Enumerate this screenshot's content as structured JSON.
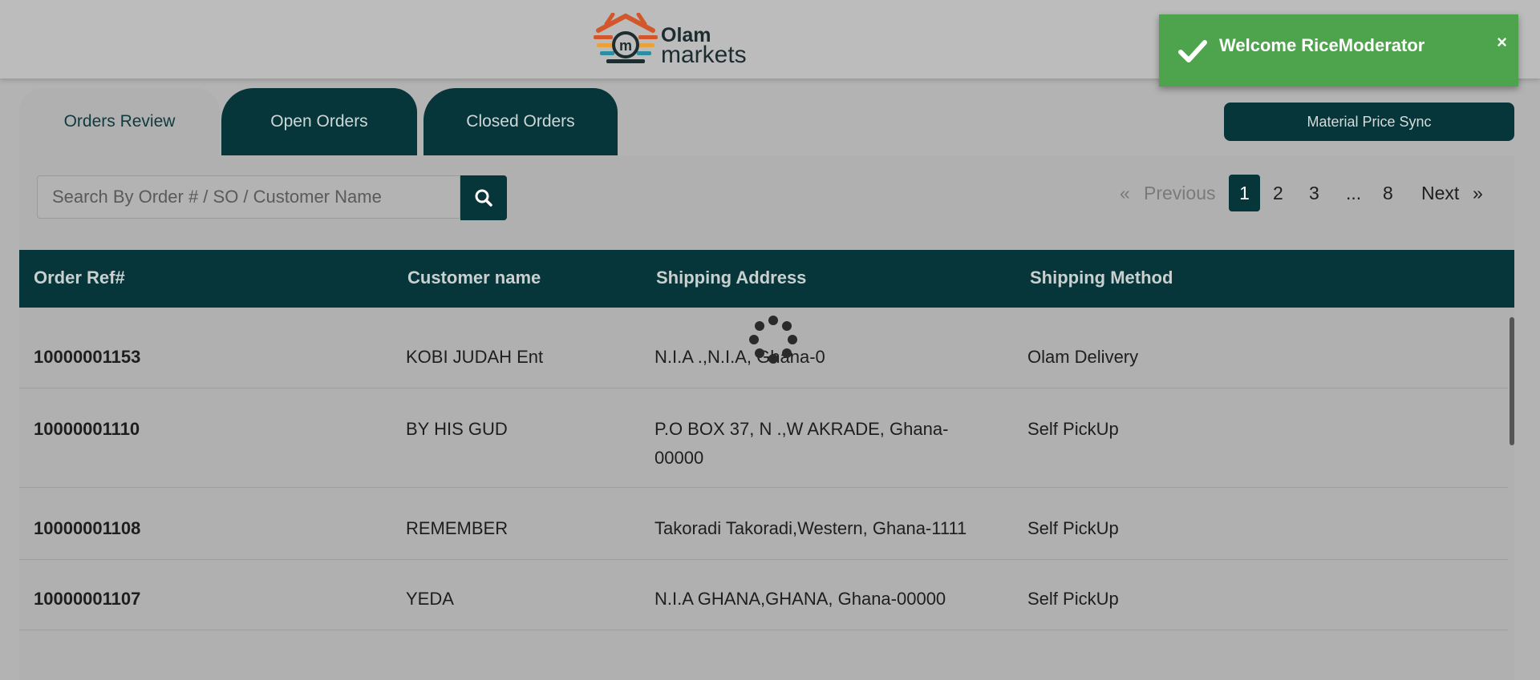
{
  "brand": {
    "line1": "Olam",
    "line2": "markets"
  },
  "toast": {
    "message": "Welcome RiceModerator",
    "close": "×",
    "color": "#4ea44c"
  },
  "tabs": [
    {
      "label": "Orders Review",
      "active": true
    },
    {
      "label": "Open Orders",
      "active": false
    },
    {
      "label": "Closed Orders",
      "active": false
    }
  ],
  "sync_button": "Material Price Sync",
  "search": {
    "placeholder": "Search By Order # / SO / Customer Name",
    "value": "",
    "icon": "search-icon"
  },
  "pagination": {
    "first": "«",
    "previous": "Previous",
    "pages": [
      "1",
      "2",
      "3",
      "...",
      "8"
    ],
    "current": "1",
    "next": "Next",
    "last": "»"
  },
  "table": {
    "headers": [
      "Order Ref#",
      "Customer name",
      "Shipping Address",
      "Shipping Method"
    ],
    "rows": [
      {
        "ref": "10000001153",
        "customer": "KOBI JUDAH Ent",
        "address_1": "N.I.A .,N.I.A, Ghana-0",
        "address_2": "",
        "method": "Olam Delivery"
      },
      {
        "ref": "10000001110",
        "customer": "BY HIS GUD",
        "address_1": "P.O BOX 37, N .,W AKRADE, Ghana-",
        "address_2": "00000",
        "method": "Self PickUp"
      },
      {
        "ref": "10000001108",
        "customer": "REMEMBER",
        "address_1": "Takoradi Takoradi,Western, Ghana-1111",
        "address_2": "",
        "method": "Self PickUp"
      },
      {
        "ref": "10000001107",
        "customer": "YEDA",
        "address_1": "N.I.A GHANA,GHANA, Ghana-00000",
        "address_2": "",
        "method": "Self PickUp"
      }
    ]
  },
  "colors": {
    "primary": "#06353a",
    "overlay": "#b0b0b0",
    "success": "#4ea44c"
  }
}
